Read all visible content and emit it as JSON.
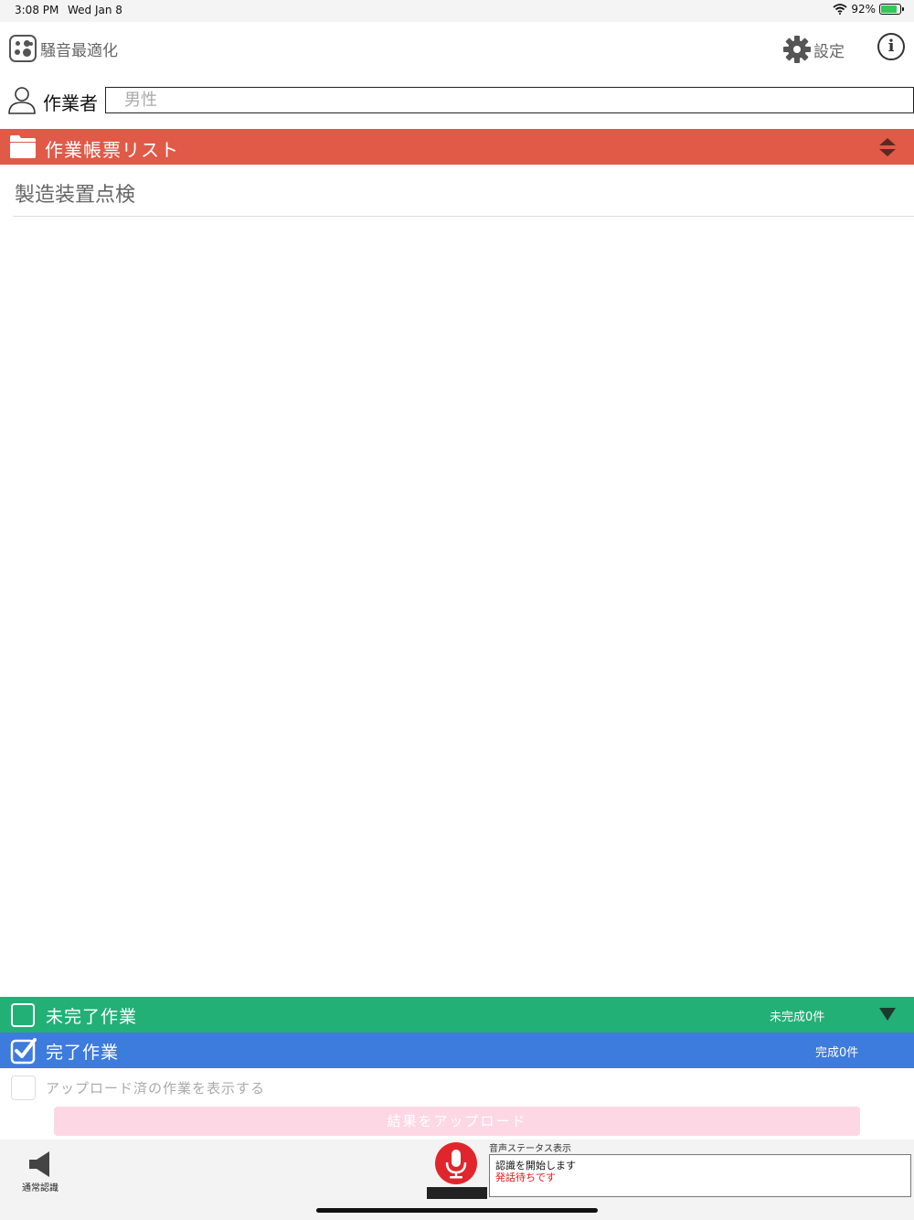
{
  "status_bar": {
    "time": "3:08 PM",
    "date": "Wed Jan 8",
    "battery": "92%"
  },
  "nav": {
    "noise_label": "騒音最適化",
    "settings_label": "設定",
    "info_label": "i"
  },
  "worker": {
    "label": "作業者",
    "placeholder": "男性",
    "value": ""
  },
  "list_header": {
    "title": "作業帳票リスト"
  },
  "list": {
    "items": [
      {
        "label": "製造装置点検"
      }
    ]
  },
  "incomplete": {
    "label": "未完了作業",
    "count": "未完成0件"
  },
  "complete": {
    "label": "完了作業",
    "count": "完成0件"
  },
  "show_uploaded": {
    "label": "アップロード済の作業を表示する"
  },
  "upload": {
    "label": "結果をアップロード"
  },
  "toolbar": {
    "mode_label": "通常認識",
    "voice_status_title": "音声ステータス表示",
    "voice_status_line1": "認識を開始します",
    "voice_status_line2": "発話待ちです"
  },
  "colors": {
    "header_red": "#e05a47",
    "incomplete_green": "#22b077",
    "complete_blue": "#3d7bdc",
    "upload_pink": "#fdd8e4",
    "mic_red": "#e0262c"
  }
}
